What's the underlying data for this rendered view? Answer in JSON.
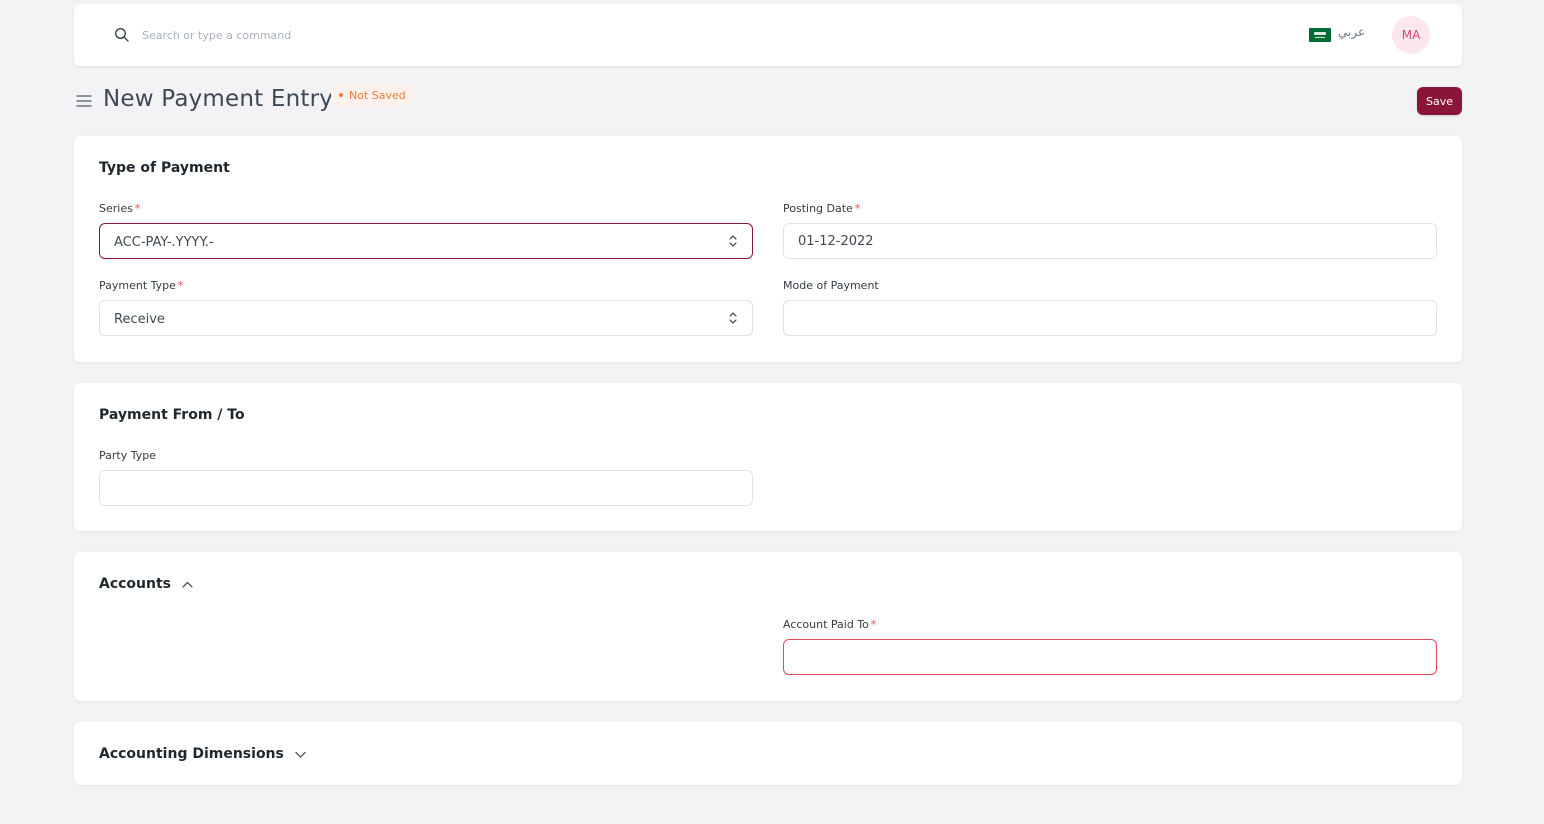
{
  "navbar": {
    "search_placeholder": "Search or type a command",
    "language_label": "عربي",
    "avatar_initials": "MA"
  },
  "header": {
    "title": "New Payment Entry",
    "status": "Not Saved",
    "save_label": "Save"
  },
  "sections": {
    "type_of_payment": {
      "title": "Type of Payment",
      "series": {
        "label": "Series",
        "value": "ACC-PAY-.YYYY.-"
      },
      "posting_date": {
        "label": "Posting Date",
        "value": "01-12-2022"
      },
      "payment_type": {
        "label": "Payment Type",
        "value": "Receive"
      },
      "mode_of_payment": {
        "label": "Mode of Payment",
        "value": ""
      }
    },
    "payment_from_to": {
      "title": "Payment From / To",
      "party_type": {
        "label": "Party Type",
        "value": ""
      }
    },
    "accounts": {
      "title": "Accounts",
      "account_paid_to": {
        "label": "Account Paid To",
        "value": ""
      }
    },
    "accounting_dimensions": {
      "title": "Accounting Dimensions"
    }
  },
  "required_marker": "*",
  "colors": {
    "brand": "#8a1538",
    "status_orange": "#ea7c3b",
    "error": "#e24c5a",
    "avatar_bg": "#fce7ef",
    "avatar_text": "#d2487b"
  }
}
